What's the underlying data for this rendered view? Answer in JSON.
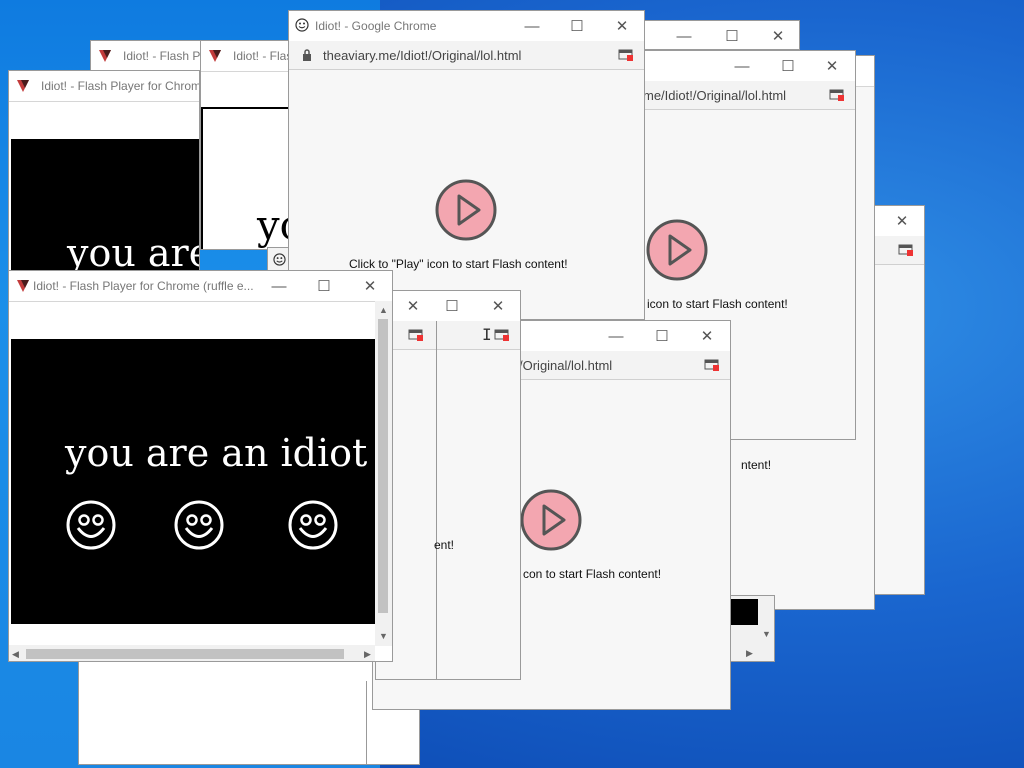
{
  "windows": {
    "chrome_title": "Idiot! - Google Chrome",
    "flash_title_short": "Idiot! - Flash Pla",
    "flash_title_short2": "Idiot! - Flash",
    "flash_title_chrome": "Idiot! - Flash Player for Chrome",
    "flash_title_front": "Idiot! - Flash Player for Chrome (ruffle e...",
    "url_full": "theaviary.me/Idiot!/Original/lol.html",
    "url_partial_a": "me/Idiot!/Original/lol.html",
    "url_partial_b": "/Original/lol.html",
    "flash_message_full": "Click to \"Play\" icon to start Flash content!",
    "flash_message_partial": "icon to start Flash content!",
    "flash_message_partial_b": "con to start Flash content!",
    "flash_fragment_a": "ntent!",
    "flash_fragment_b": "ent!",
    "flash_fragment_c": "ent!",
    "idiot_text": "you are an idiot",
    "idiot_text_partial": "you are",
    "idiot_text_yo": "yo"
  },
  "controls": {
    "minimize": "—",
    "maximize": "☐",
    "close": "✕"
  },
  "colors": {
    "play_fill": "#f3a6b0",
    "play_stroke": "#555555",
    "flash_bg": "#000000"
  }
}
